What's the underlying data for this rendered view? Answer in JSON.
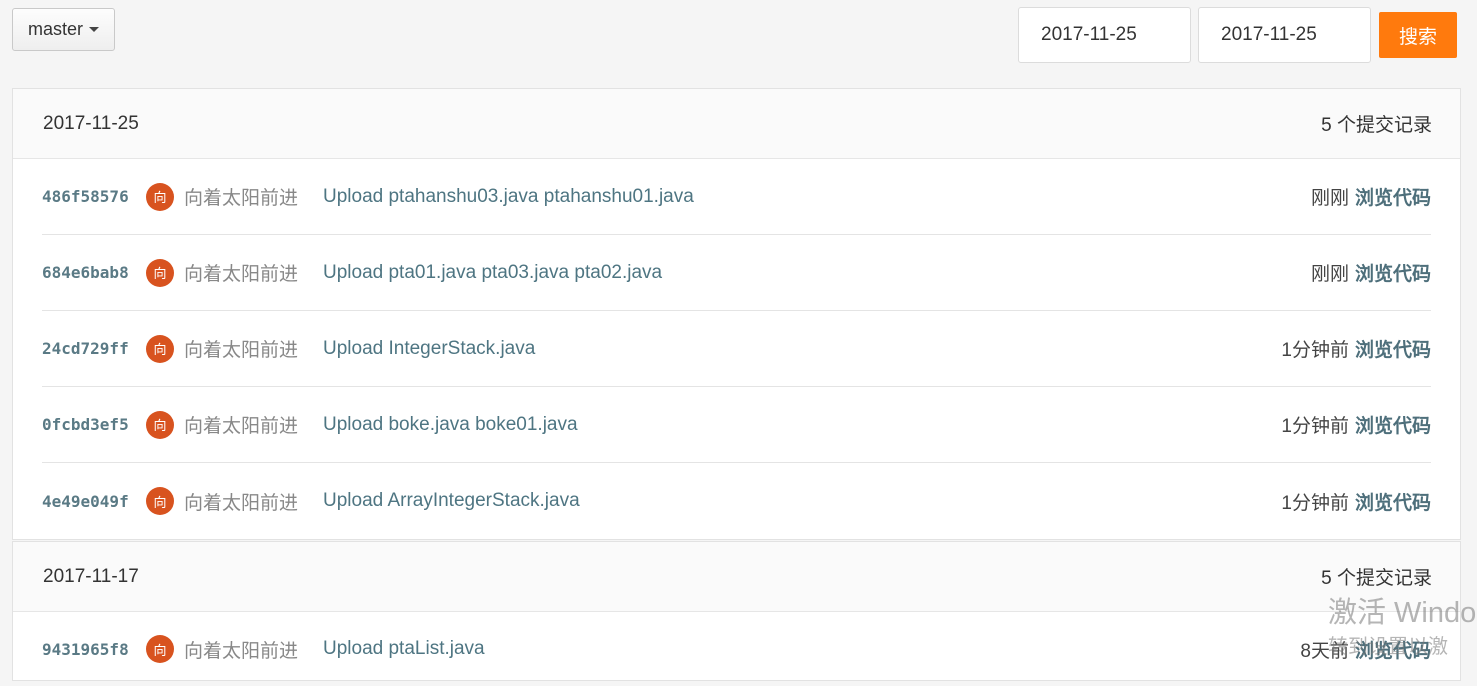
{
  "branch": {
    "label": "master"
  },
  "filters": {
    "start_date": "2017-11-25",
    "end_date": "2017-11-25",
    "search_label": "搜索"
  },
  "groups": [
    {
      "date": "2017-11-25",
      "count_label": "5 个提交记录",
      "commits": [
        {
          "sha": "486f58576",
          "avatar": "向",
          "author": "向着太阳前进",
          "message": "Upload ptahanshu03.java ptahanshu01.java",
          "time": "刚刚",
          "browse": "浏览代码"
        },
        {
          "sha": "684e6bab8",
          "avatar": "向",
          "author": "向着太阳前进",
          "message": "Upload pta01.java pta03.java pta02.java",
          "time": "刚刚",
          "browse": "浏览代码"
        },
        {
          "sha": "24cd729ff",
          "avatar": "向",
          "author": "向着太阳前进",
          "message": "Upload IntegerStack.java",
          "time": "1分钟前",
          "browse": "浏览代码"
        },
        {
          "sha": "0fcbd3ef5",
          "avatar": "向",
          "author": "向着太阳前进",
          "message": "Upload boke.java boke01.java",
          "time": "1分钟前",
          "browse": "浏览代码"
        },
        {
          "sha": "4e49e049f",
          "avatar": "向",
          "author": "向着太阳前进",
          "message": "Upload ArrayIntegerStack.java",
          "time": "1分钟前",
          "browse": "浏览代码"
        }
      ]
    },
    {
      "date": "2017-11-17",
      "count_label": "5 个提交记录",
      "commits": [
        {
          "sha": "9431965f8",
          "avatar": "向",
          "author": "向着太阳前进",
          "message": "Upload ptaList.java",
          "time": "8天前",
          "browse": "浏览代码"
        }
      ]
    }
  ],
  "watermark": {
    "line1": "激活 Windo",
    "line2": "转到设置以激"
  }
}
